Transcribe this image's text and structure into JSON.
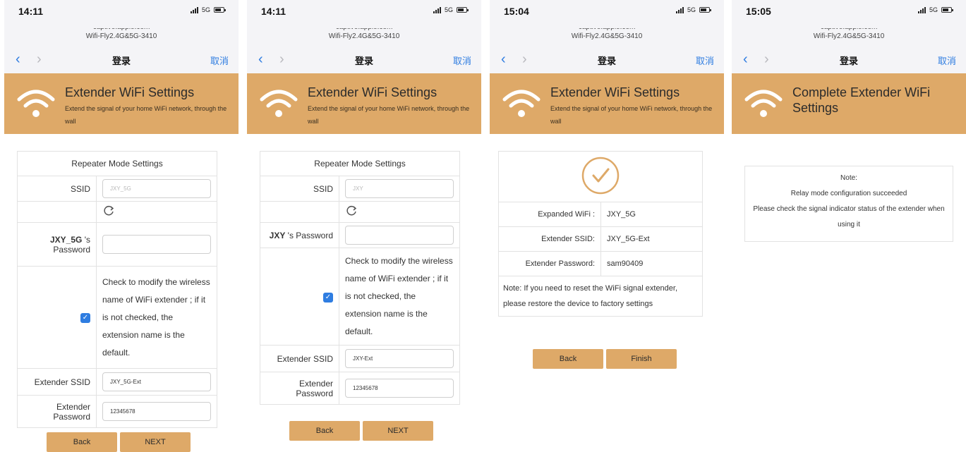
{
  "common": {
    "url_host": "captive.apple.com",
    "url_ssid": "Wifi-Fly2.4G&5G-3410",
    "nav_title": "登录",
    "nav_cancel": "取消",
    "network": "5G",
    "banner_sub": "Extend the signal of your home WiFi network, through the wall",
    "back": "Back",
    "next": "NEXT",
    "finish": "Finish",
    "accent_color": "#dea968",
    "link_color": "#2f7de1"
  },
  "screen1": {
    "time": "14:11",
    "banner_title": "Extender WiFi Settings",
    "table_title": "Repeater Mode Settings",
    "ssid_label": "SSID",
    "ssid_value": "JXY_5G",
    "password_label_ssid": "JXY_5G",
    "password_label_suffix": " 's Password",
    "password_value": "",
    "checkbox_note": "Check to modify the wireless name of WiFi extender ; if it is not checked, the extension name is the default.",
    "ext_ssid_label": "Extender SSID",
    "ext_ssid_value": "JXY_5G-Ext",
    "ext_pwd_label": "Extender Password",
    "ext_pwd_value": "12345678"
  },
  "screen2": {
    "time": "14:11",
    "banner_title": "Extender WiFi Settings",
    "table_title": "Repeater Mode Settings",
    "ssid_label": "SSID",
    "ssid_value": "JXY",
    "password_label_ssid": "JXY",
    "password_label_suffix": " 's Password",
    "password_value": "",
    "checkbox_note": "Check to modify the wireless name of WiFi extender ; if it is not checked, the extension name is the default.",
    "ext_ssid_label": "Extender SSID",
    "ext_ssid_value": "JXY-Ext",
    "ext_pwd_label": "Extender Password",
    "ext_pwd_value": "12345678"
  },
  "screen3": {
    "time": "15:04",
    "banner_title": "Extender WiFi Settings",
    "expanded_label": "Expanded WiFi :",
    "expanded_value": "JXY_5G",
    "ext_ssid_label": "Extender SSID:",
    "ext_ssid_value": "JXY_5G-Ext",
    "ext_pwd_label": "Extender Password:",
    "ext_pwd_value": "sam90409",
    "note": "Note: If you need to reset the WiFi signal extender, please restore the device to factory settings"
  },
  "screen4": {
    "time": "15:05",
    "banner_title": "Complete Extender WiFi Settings",
    "note_title": "Note:",
    "note_line1": "Relay mode configuration succeeded",
    "note_line2": "Please check the signal indicator status of the extender when using it"
  }
}
